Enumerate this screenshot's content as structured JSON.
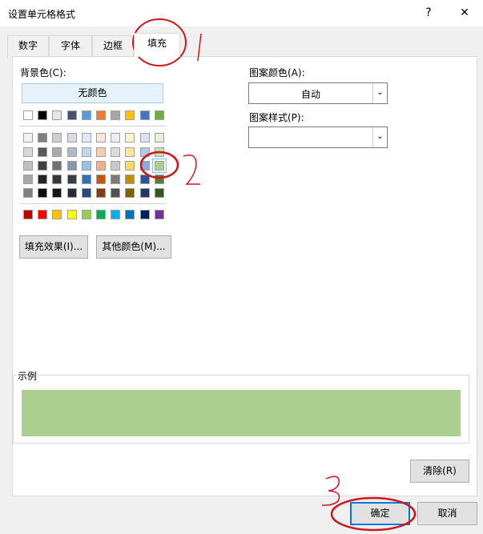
{
  "window": {
    "title": "设置单元格格式",
    "help": "?",
    "close": "✕"
  },
  "tabs": [
    {
      "label": "数字"
    },
    {
      "label": "字体"
    },
    {
      "label": "边框"
    },
    {
      "label": "填充"
    }
  ],
  "fill": {
    "background_label": "背景色(C):",
    "no_color": "无颜色",
    "theme_row": [
      "#FFFFFF",
      "#000000",
      "#E7E6E6",
      "#44546A",
      "#5B9BD5",
      "#ED7D31",
      "#A5A5A5",
      "#FFC000",
      "#4472C4",
      "#70AD47"
    ],
    "tint_rows": [
      [
        "#F2F2F2",
        "#7F7F7F",
        "#D0CECE",
        "#D6DCE4",
        "#DDEBF7",
        "#FCE4D6",
        "#EDEDED",
        "#FFF2CC",
        "#D9E1F2",
        "#E2EFDA"
      ],
      [
        "#D9D9D9",
        "#595959",
        "#AEAAAA",
        "#ACB9CA",
        "#BDD7EE",
        "#F8CBAD",
        "#DBDBDB",
        "#FFE699",
        "#B4C6E7",
        "#C6E0B4"
      ],
      [
        "#BFBFBF",
        "#404040",
        "#757171",
        "#8497B0",
        "#9BC2E6",
        "#F4B084",
        "#C9C9C9",
        "#FFD966",
        "#8EA9DB",
        "#A9D08E"
      ],
      [
        "#A6A6A6",
        "#262626",
        "#3A3838",
        "#333F4F",
        "#2F75B5",
        "#C65911",
        "#7B7B7B",
        "#BF8F00",
        "#305496",
        "#548235"
      ],
      [
        "#808080",
        "#0D0D0D",
        "#161616",
        "#222B35",
        "#1F4E78",
        "#833C0C",
        "#525252",
        "#806000",
        "#203764",
        "#375623"
      ]
    ],
    "standard_row": [
      "#C00000",
      "#FF0000",
      "#FFC000",
      "#FFFF00",
      "#92D050",
      "#00B050",
      "#00B0F0",
      "#0070C0",
      "#002060",
      "#7030A0"
    ],
    "selected": {
      "row": 3,
      "col": 9
    },
    "fill_effects": "填充效果(I)...",
    "more_colors": "其他颜色(M)...",
    "pattern_color_label": "图案颜色(A):",
    "pattern_color_value": "自动",
    "pattern_style_label": "图案样式(P):",
    "pattern_style_value": "",
    "sample_label": "示例",
    "sample_color": "#A9D08E",
    "clear": "清除(R)"
  },
  "footer": {
    "ok": "确定",
    "cancel": "取消"
  },
  "annotations": [
    "1",
    "2",
    "3"
  ]
}
